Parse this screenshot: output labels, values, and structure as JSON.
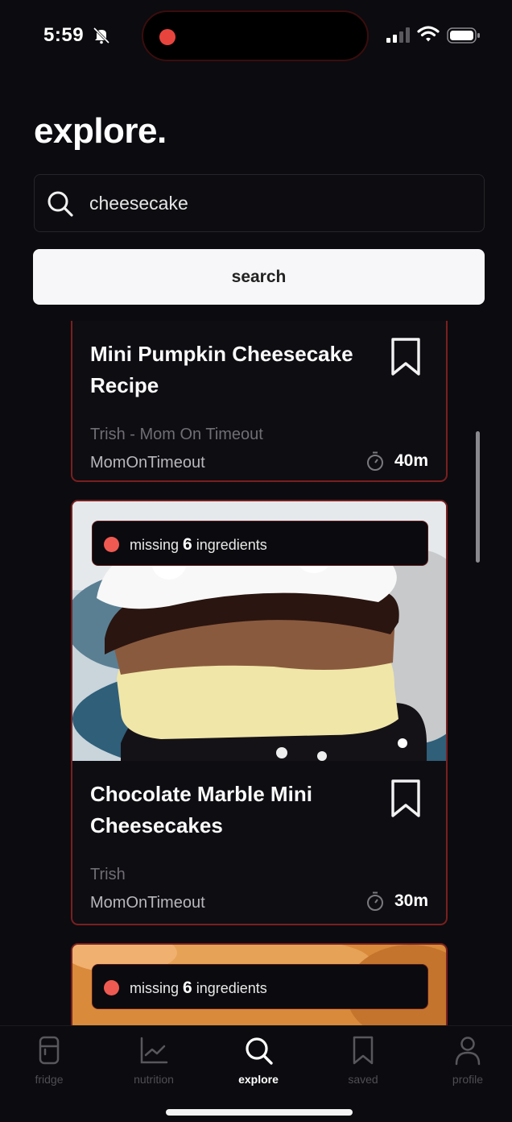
{
  "status_bar": {
    "time": "5:59"
  },
  "page": {
    "title": "explore."
  },
  "search": {
    "value": "cheesecake",
    "button_label": "search"
  },
  "cards": [
    {
      "title": "Mini Pumpkin Cheesecake Recipe",
      "author": "Trish - Mom On Timeout",
      "source": "MomOnTimeout",
      "time": "40m"
    },
    {
      "badge": {
        "prefix": "missing",
        "count": "6",
        "suffix": "ingredients"
      },
      "title": "Chocolate Marble Mini Cheesecakes",
      "author": "Trish",
      "source": "MomOnTimeout",
      "time": "30m"
    },
    {
      "badge": {
        "prefix": "missing",
        "count": "6",
        "suffix": "ingredients"
      }
    }
  ],
  "tabs": [
    {
      "label": "fridge",
      "icon": "fridge-icon",
      "active": false
    },
    {
      "label": "nutrition",
      "icon": "chart-icon",
      "active": false
    },
    {
      "label": "explore",
      "icon": "search-icon",
      "active": true
    },
    {
      "label": "saved",
      "icon": "bookmark-icon",
      "active": false
    },
    {
      "label": "profile",
      "icon": "person-icon",
      "active": false
    }
  ],
  "colors": {
    "accent": "#e8443e",
    "background": "#0c0b0f",
    "card_border": "#7a1f1f"
  }
}
